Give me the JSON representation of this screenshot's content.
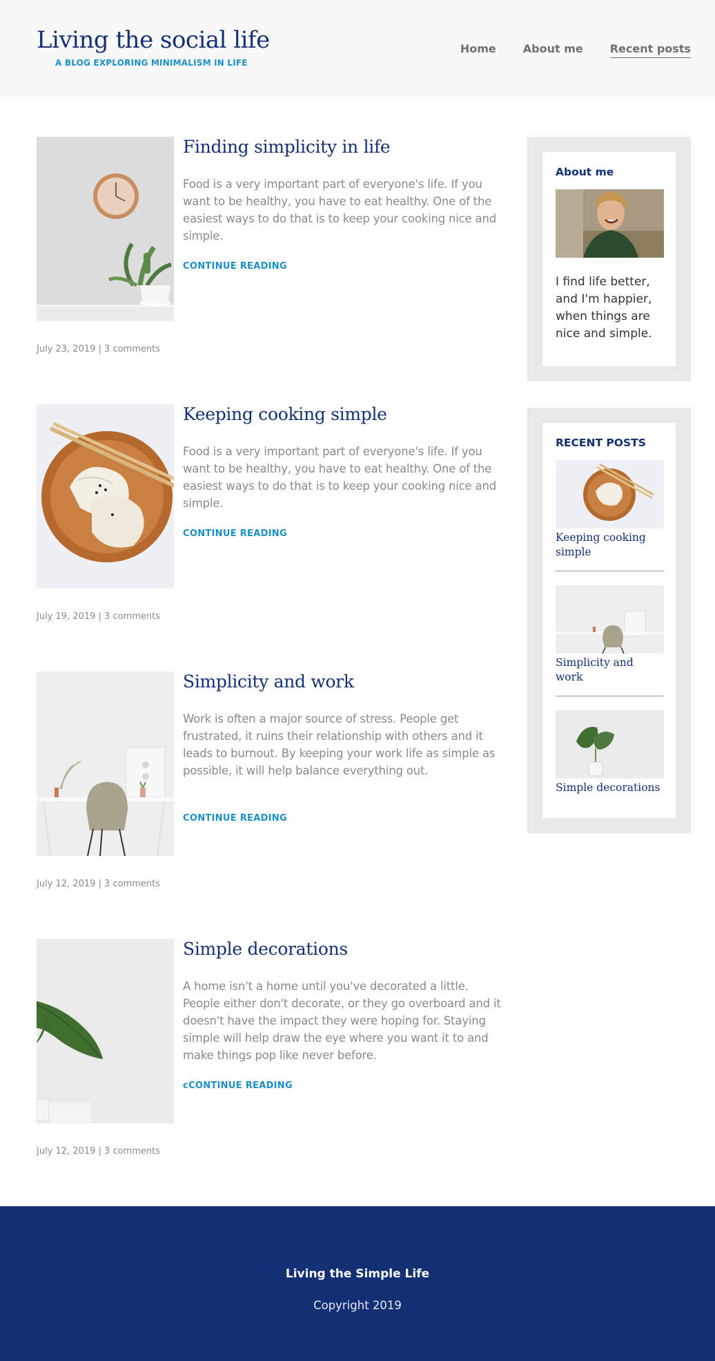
{
  "header": {
    "title": "Living the social life",
    "subtitle": "A BLOG EXPLORING MINIMALISM IN LIFE",
    "nav": [
      {
        "label": "Home"
      },
      {
        "label": "About me"
      },
      {
        "label": "Recent posts",
        "active": true
      }
    ]
  },
  "posts": [
    {
      "title": "Finding simplicity in life",
      "excerpt": "Food is a very important part of everyone's life. If you want to be healthy, you have to eat healthy. One of the easiest ways to do that is to keep your cooking nice and simple.",
      "more": "CONTINUE READING",
      "meta": "July 23, 2019 | 3 comments",
      "image": "wall-clock-and-plant"
    },
    {
      "title": "Keeping cooking simple",
      "excerpt": "Food is a very important part of everyone's life. If you want to be healthy, you have to eat healthy. One of the easiest ways to do that is to keep your cooking nice and simple.",
      "more": "CONTINUE READING",
      "meta": "July 19, 2019 | 3 comments",
      "image": "dumplings-on-wooden-plate"
    },
    {
      "title": "Simplicity and work",
      "excerpt": "Work is often a major source of stress. People get frustrated, it ruins their relationship with others and it leads to burnout. By keeping your work life as simple as possible, it will help balance everything out.",
      "more": "CONTINUE READING",
      "meta": "July 12, 2019 | 3 comments",
      "image": "white-desk-and-chair"
    },
    {
      "title": "Simple decorations",
      "excerpt": "A home isn't a home until you've decorated a little. People either don't decorate, or they go overboard and it doesn't have the impact they were hoping for. Staying simple will help draw the eye where you want it to and make things pop like never before.",
      "more": "cCONTINUE READING",
      "meta": "July 12, 2019 | 3 comments",
      "image": "leaf-in-glass"
    }
  ],
  "sidebar": {
    "about": {
      "heading": "About me",
      "text": "I find life better, and I'm happier, when things are nice and simple.",
      "image": "smiling-person-portrait"
    },
    "recent": {
      "heading": "RECENT POSTS",
      "items": [
        {
          "title": "Keeping cooking simple",
          "image": "dumplings-on-wooden-plate"
        },
        {
          "title": "Simplicity and work",
          "image": "white-desk-and-chair"
        },
        {
          "title": "Simple decorations",
          "image": "leaf-in-glass"
        }
      ]
    }
  },
  "footer": {
    "title": "Living the Simple Life",
    "copyright": "Copyright 2019"
  },
  "colors": {
    "brand_navy": "#143074",
    "link_blue": "#1b8fc7",
    "header_bg": "#f8f8f8",
    "sidebar_bg": "#e8e8e8"
  }
}
